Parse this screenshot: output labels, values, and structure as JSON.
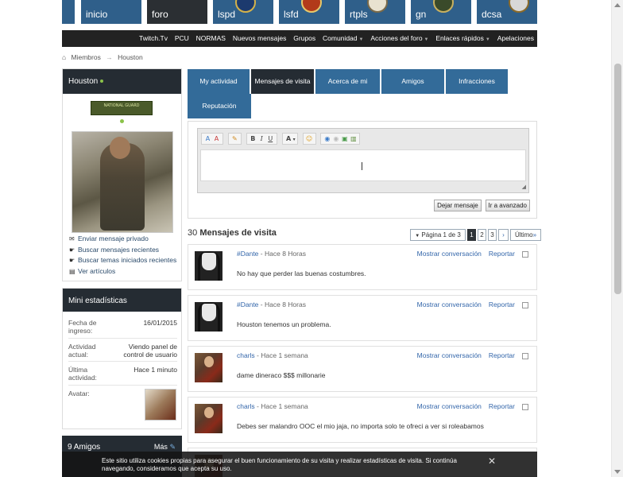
{
  "top_tiles": [
    {
      "label": "inicio"
    },
    {
      "label": "foro"
    },
    {
      "label": "lspd"
    },
    {
      "label": "lsfd"
    },
    {
      "label": "rtpls"
    },
    {
      "label": "gn"
    },
    {
      "label": "dcsa"
    }
  ],
  "nav": {
    "items": [
      "Twitch.Tv",
      "PCU",
      "NORMAS",
      "Nuevos mensajes",
      "Grupos",
      "Comunidad",
      "Acciones del foro",
      "Enlaces rápidos",
      "Apelaciones"
    ]
  },
  "breadcrumb": {
    "home": "Miembros",
    "current": "Houston"
  },
  "profile": {
    "name": "Houston",
    "badge_text": "NATIONAL GUARD",
    "links": [
      "Enviar mensaje privado",
      "Buscar mensajes recientes",
      "Buscar temas iniciados recientes",
      "Ver artículos"
    ]
  },
  "stats": {
    "title": "Mini estadísticas",
    "rows": [
      {
        "k": "Fecha de ingreso:",
        "v": "16/01/2015"
      },
      {
        "k": "Actividad actual:",
        "v": "Viendo panel de control de usuario"
      },
      {
        "k": "Última actividad:",
        "v": "Hace 1 minuto"
      },
      {
        "k": "Avatar:",
        "v": ""
      }
    ]
  },
  "friends": {
    "title": "9 Amigos",
    "more": "Más"
  },
  "tabs": [
    "My actividad",
    "Mensajes de visita",
    "Acerca de mi",
    "Amigos",
    "Infracciones",
    "Reputación"
  ],
  "editor": {
    "buttons": {
      "post": "Dejar mensaje",
      "advanced": "Ir a avanzado"
    }
  },
  "messages_header": {
    "count": "30",
    "label": "Mensajes de visita"
  },
  "pager": {
    "label": "Página 1 de 3",
    "pages": [
      "1",
      "2",
      "3"
    ],
    "next": "›",
    "last": "Último"
  },
  "messages": [
    {
      "user": "#Dante",
      "time": "Hace 8 Horas",
      "text": "No hay que perder las buenas costumbres.",
      "avatar": "mask"
    },
    {
      "user": "#Dante",
      "time": "Hace 8 Horas",
      "text": "Houston tenemos un problema.",
      "avatar": "mask"
    },
    {
      "user": "charls",
      "time": "Hace 1 semana",
      "text": "dame dineraco $$$ millonarie",
      "avatar": "painting"
    },
    {
      "user": "charls",
      "time": "Hace 1 semana",
      "text": "Debes ser malandro OOC el mio jaja, no importa solo te ofreci a ver si roleabamos",
      "avatar": "painting"
    }
  ],
  "message_actions": {
    "conversation": "Mostrar conversación",
    "report": "Reportar"
  },
  "cookie": {
    "text": "Este sitio utiliza cookies propias para asegurar el buen funcionamiento de su visita y realizar estadísticas de visita. Si continúa navegando, consideramos que acepta su uso.",
    "close": "✕"
  },
  "colors": {
    "tab": "#336b99",
    "tab_active": "#252c33",
    "header_dark": "#252c33",
    "link": "#3366aa"
  }
}
